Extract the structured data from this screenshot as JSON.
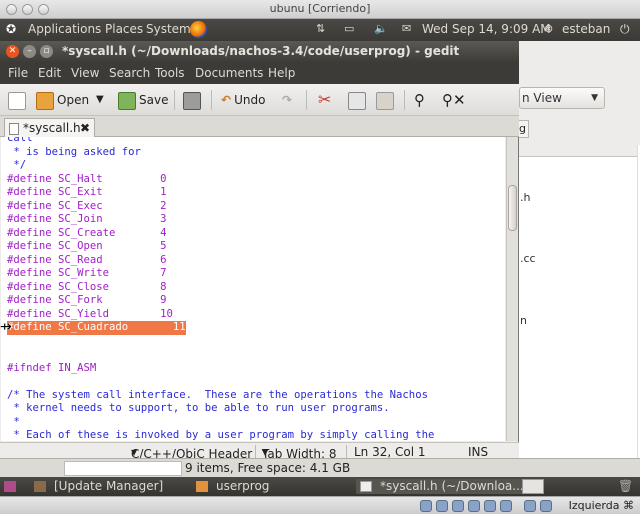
{
  "vbox": {
    "window_title": "ubunu [Corriendo]",
    "host_key": "Izquierda ⌘"
  },
  "top_panel": {
    "applications": "Applications",
    "places": "Places",
    "system": "System",
    "datetime": "Wed Sep 14,  9:09 AM",
    "user": "esteban"
  },
  "gedit": {
    "window_title": "*syscall.h (~/Downloads/nachos-3.4/code/userprog) - gedit",
    "menu": [
      "File",
      "Edit",
      "View",
      "Search",
      "Tools",
      "Documents",
      "Help"
    ],
    "toolbar": {
      "open_label": "Open",
      "save_label": "Save",
      "undo_label": "Undo"
    },
    "tab_label": "*syscall.h",
    "code_lines": [
      {
        "text": "call",
        "kind": "cm"
      },
      {
        "text": " * is being asked for",
        "kind": "cm"
      },
      {
        "text": " */",
        "kind": "cm"
      },
      {
        "text": "#define SC_Halt         0",
        "kind": "pp"
      },
      {
        "text": "#define SC_Exit         1",
        "kind": "pp"
      },
      {
        "text": "#define SC_Exec         2",
        "kind": "pp"
      },
      {
        "text": "#define SC_Join         3",
        "kind": "pp"
      },
      {
        "text": "#define SC_Create       4",
        "kind": "pp"
      },
      {
        "text": "#define SC_Open         5",
        "kind": "pp"
      },
      {
        "text": "#define SC_Read         6",
        "kind": "pp"
      },
      {
        "text": "#define SC_Write        7",
        "kind": "pp"
      },
      {
        "text": "#define SC_Close        8",
        "kind": "pp"
      },
      {
        "text": "#define SC_Fork         9",
        "kind": "pp"
      },
      {
        "text": "#define SC_Yield        10",
        "kind": "pp"
      },
      {
        "text": "#define SC_Cuadrado       11",
        "kind": "hl"
      },
      {
        "text": "",
        "kind": "pp"
      },
      {
        "text": "",
        "kind": "pp"
      },
      {
        "text": "#ifndef IN_ASM",
        "kind": "pp"
      },
      {
        "text": "",
        "kind": "pp"
      },
      {
        "text": "/* The system call interface.  These are the operations the Nachos",
        "kind": "cm"
      },
      {
        "text": " * kernel needs to support, to be able to run user programs.",
        "kind": "cm"
      },
      {
        "text": " *",
        "kind": "cm"
      },
      {
        "text": " * Each of these is invoked by a user program by simply calling the",
        "kind": "cm"
      }
    ],
    "status": {
      "language": "C/C++/ObjC Header",
      "tab_width": "Tab Width: 8",
      "position": "Ln 32, Col 1",
      "mode": "INS"
    }
  },
  "nautilus": {
    "view_selector": "n View",
    "files": [
      ".h",
      ".cc",
      "n"
    ],
    "info": "9 items, Free space: 4.1 GB"
  },
  "taskbar": {
    "items": [
      "[Update Manager]",
      "userprog",
      "*syscall.h (~/Downloa..."
    ]
  }
}
